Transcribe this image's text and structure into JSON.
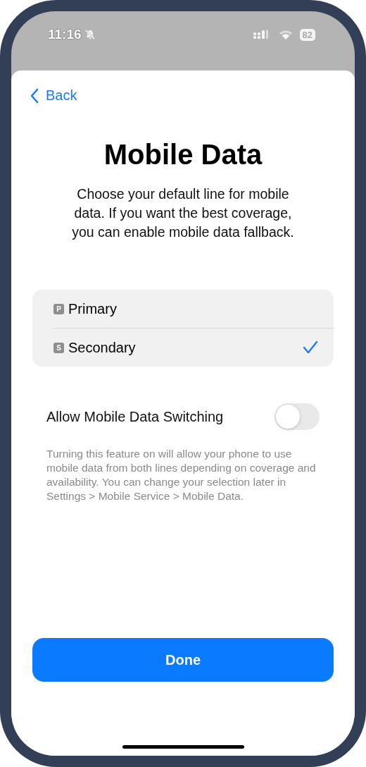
{
  "status_bar": {
    "time": "11:16",
    "silent": true,
    "battery": "82"
  },
  "nav": {
    "back": "Back"
  },
  "title": "Mobile Data",
  "description": "Choose your default line for mobile data. If you want the best coverage, you can enable mobile data fallback.",
  "lines": [
    {
      "badge": "P",
      "label": "Primary",
      "selected": false
    },
    {
      "badge": "S",
      "label": "Secondary",
      "selected": true
    }
  ],
  "switch": {
    "label": "Allow Mobile Data Switching",
    "on": false
  },
  "footnote": "Turning this feature on will allow your phone to use mobile data from both lines depending on coverage and availability. You can change your selection later in Settings > Mobile Service > Mobile Data.",
  "button": "Done"
}
